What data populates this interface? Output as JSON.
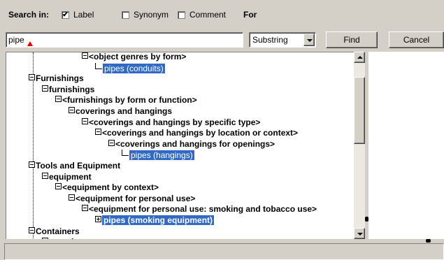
{
  "search": {
    "search_in_label": "Search in:",
    "label_option": "Label",
    "label_checked": "✔",
    "synonym_option": "Synonym",
    "comment_option": "Comment",
    "for_label": "For",
    "query_value": "pipe",
    "match_mode": "Substring",
    "find_button": "Find",
    "cancel_button": "Cancel"
  },
  "tree": {
    "nodes": [
      {
        "label": "<object genres by form>",
        "toggle": "minus",
        "depth": 4
      },
      {
        "label": "pipes (conduits)",
        "selected": true,
        "depth": 5
      },
      {
        "label": "Furnishings",
        "toggle": "minus",
        "depth": 0
      },
      {
        "label": "furnishings",
        "toggle": "minus",
        "depth": 1
      },
      {
        "label": "<furnishings by form  or  function>",
        "toggle": "minus",
        "depth": 2
      },
      {
        "label": "coverings and hangings",
        "toggle": "minus",
        "depth": 3
      },
      {
        "label": "<coverings and hangings by  specific type>",
        "toggle": "minus",
        "depth": 4
      },
      {
        "label": "<coverings and hangings by  location or context>",
        "toggle": "minus",
        "depth": 5
      },
      {
        "label": "<coverings and hangings for  openings>",
        "toggle": "minus",
        "depth": 6
      },
      {
        "label": "pipes (hangings)",
        "selected": true,
        "depth": 7
      },
      {
        "label": "Tools and Equipment",
        "toggle": "minus",
        "depth": 0
      },
      {
        "label": "equipment",
        "toggle": "minus",
        "depth": 1
      },
      {
        "label": "<equipment by context>",
        "toggle": "minus",
        "depth": 2
      },
      {
        "label": "<equipment for personal  use>",
        "toggle": "minus",
        "depth": 3
      },
      {
        "label": "<equipment for personal use:  smoking and tobacco use>",
        "toggle": "minus",
        "depth": 4
      },
      {
        "label": "pipes (smoking equipment)",
        "toggle": "plus",
        "selected": true,
        "depth": 5
      },
      {
        "label": "Containers",
        "toggle": "minus",
        "depth": 0
      },
      {
        "label": "containers",
        "toggle": "minus",
        "depth": 1
      }
    ]
  },
  "colors": {
    "selection": "#316ac5",
    "window_bg": "#d4d0c8"
  }
}
